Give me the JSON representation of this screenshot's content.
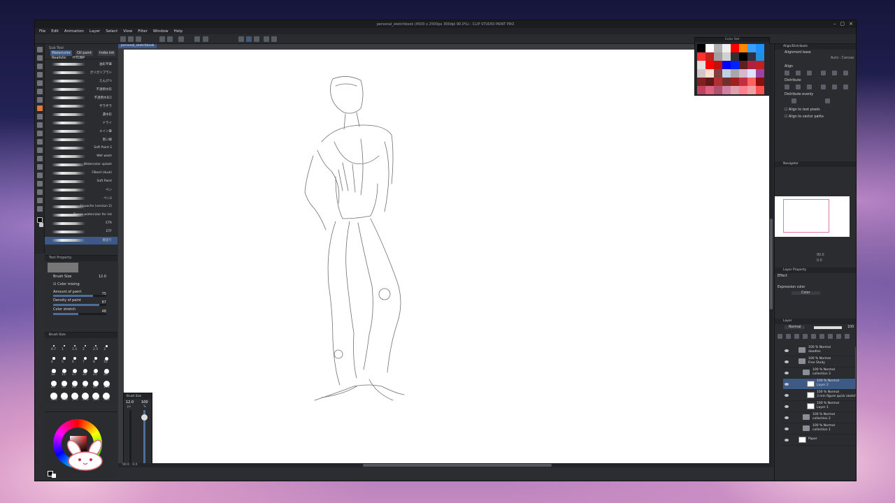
{
  "window": {
    "title": "personal_sketchbook (4500 x 2500px 300dpi 90.0%) - CLIP STUDIO PAINT PRO",
    "close": "×",
    "minimize": "–",
    "maximize": "▢"
  },
  "menu": [
    "File",
    "Edit",
    "Animation",
    "Layer",
    "Select",
    "View",
    "Filter",
    "Window",
    "Help"
  ],
  "document_tab": "personal_sketchbook",
  "sub_tool": {
    "header": "Sub Tool",
    "tabs": [
      "Watercolor",
      "Oil paint",
      "India ink",
      "Realistic",
      "HTDBP"
    ],
    "brushes": [
      "油彩平筆",
      "ガリガリブラシ",
      "えんぴつ",
      "不透明水彩",
      "不透明水彩2",
      "ザラザラ",
      "濃水彩",
      "ドライ",
      "メイン筆",
      "黒い線",
      "Soft Paint 2",
      "Wet wash",
      "Watercolor splash",
      "Filbert (dual)",
      "Soft Paint",
      "ペン",
      "ペン2",
      "Gouache (version 2)",
      "Dense watercolor for ink",
      "ETR",
      "ETF",
      "厚塗り"
    ],
    "selected_index": 21
  },
  "tool_property": {
    "header": "Tool Property",
    "brush_size_label": "Brush Size",
    "brush_size": "12.0",
    "color_mixing_label": "Color mixing",
    "amount_label": "Amount of paint",
    "amount": "75",
    "density_label": "Density of paint",
    "density": "87",
    "stretch_label": "Color stretch",
    "stretch": "48",
    "amount_fraction": 0.75,
    "density_fraction": 0.87,
    "stretch_fraction": 0.48
  },
  "brush_size_palette": {
    "header": "Brush Size",
    "sizes": [
      "0.7",
      "1",
      "1.5",
      "2",
      "2.5",
      "3",
      "4",
      "5",
      "6",
      "7",
      "8",
      "10",
      "12",
      "15",
      "17",
      "20",
      "25",
      "30",
      "40",
      "50",
      "60",
      "70",
      "80",
      "100",
      "120",
      "150",
      "170",
      "200",
      "250",
      "300"
    ]
  },
  "size_popup": {
    "header": "Brush Size",
    "value": "12.0",
    "unit": "px",
    "opacity": "100",
    "opacity_unit": "%"
  },
  "color_set": {
    "header": "Color Set",
    "colors": [
      "#000000",
      "#ffffff",
      "#b0b0b0",
      "#f0f0f0",
      "#ff0000",
      "#ff8800",
      "#3aa0ff",
      "#1e90ff",
      "#ff3030",
      "#c02020",
      "#a0a0a0",
      "#d0d0d0",
      "#303030",
      "#000000",
      "#303040",
      "#2090e0",
      "#e0e0e0",
      "#ff0000",
      "#c01010",
      "#0000ff",
      "#0020ff",
      "#602020",
      "#b02040",
      "#c02020",
      "#d0c8c8",
      "#ffe0d0",
      "#804040",
      "#c0d0e0",
      "#a8a8a8",
      "#d8b8c8",
      "#e0e0ff",
      "#a040a0",
      "#802020",
      "#601818",
      "#b03030",
      "#703030",
      "#a02020",
      "#c03040",
      "#ff6060",
      "#8a1010",
      "#c04060",
      "#e06080",
      "#b05070",
      "#d080a0",
      "#e0a0b0",
      "#ff8090",
      "#f0a0a0",
      "#ff5050"
    ]
  },
  "right": {
    "align_header": "Align/Distribute",
    "alignment_base": "Alignment base",
    "auto_canvas": "Auto : Canvas",
    "align": "Align",
    "distribute": "Distribute",
    "distribute_evenly": "Distribute evenly",
    "align_text_pixels": "Align to text pixels",
    "align_vector_paths": "Align to vector paths",
    "navigator_header": "Navigator",
    "zoom": "90.0",
    "rotation": "0.0",
    "layer_property_header": "Layer Property",
    "effect": "Effect",
    "expression_color": "Expression color",
    "color_mode": "Color",
    "layer_header": "Layer",
    "blend_mode": "Normal",
    "opacity": "100"
  },
  "layers": [
    {
      "mode": "100 % Normal",
      "name": "doodles",
      "type": "folder",
      "indent": 0,
      "selected": false
    },
    {
      "mode": "100 % Normal",
      "name": "Free Study",
      "type": "folder",
      "indent": 0,
      "selected": false
    },
    {
      "mode": "100 % Normal",
      "name": "collection 3",
      "type": "folder",
      "indent": 1,
      "selected": false
    },
    {
      "mode": "100 % Normal",
      "name": "Layer 2",
      "type": "raster",
      "indent": 2,
      "selected": true
    },
    {
      "mode": "100 % Normal",
      "name": "3 min figure quick sketch",
      "type": "raster",
      "indent": 2,
      "selected": false
    },
    {
      "mode": "100 % Normal",
      "name": "Layer 1",
      "type": "raster",
      "indent": 2,
      "selected": false
    },
    {
      "mode": "100 % Normal",
      "name": "collection 2",
      "type": "folder",
      "indent": 1,
      "selected": false
    },
    {
      "mode": "100 % Normal",
      "name": "collection 1",
      "type": "folder",
      "indent": 1,
      "selected": false
    },
    {
      "mode": "",
      "name": "Paper",
      "type": "paper",
      "indent": 0,
      "selected": false
    }
  ],
  "status": {
    "zoom": "90.0",
    "rotation": "0.0"
  }
}
